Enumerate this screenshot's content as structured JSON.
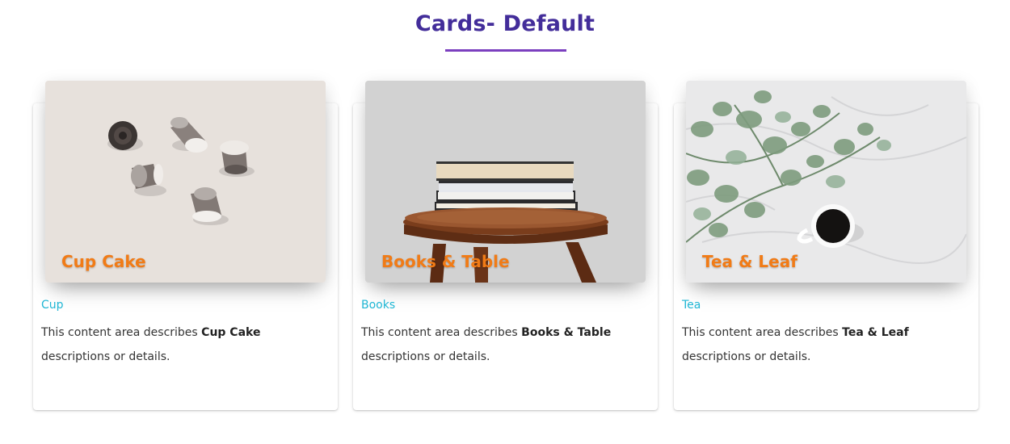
{
  "heading": "Cards- Default",
  "cards": [
    {
      "media_title": "Cup Cake",
      "category": "Cup",
      "desc_prefix": "This content area describes ",
      "desc_bold": "Cup Cake",
      "desc_suffix": " descriptions or details."
    },
    {
      "media_title": "Books & Table",
      "category": "Books",
      "desc_prefix": "This content area describes ",
      "desc_bold": "Books & Table",
      "desc_suffix": " descriptions or details."
    },
    {
      "media_title": "Tea & Leaf",
      "category": "Tea",
      "desc_prefix": "This content area describes ",
      "desc_bold": "Tea & Leaf",
      "desc_suffix": " descriptions or details."
    }
  ],
  "colors": {
    "heading": "#432d9a",
    "heading_rule": "#7b3fbf",
    "media_title": "#f17b16",
    "category": "#1fb6d4"
  }
}
